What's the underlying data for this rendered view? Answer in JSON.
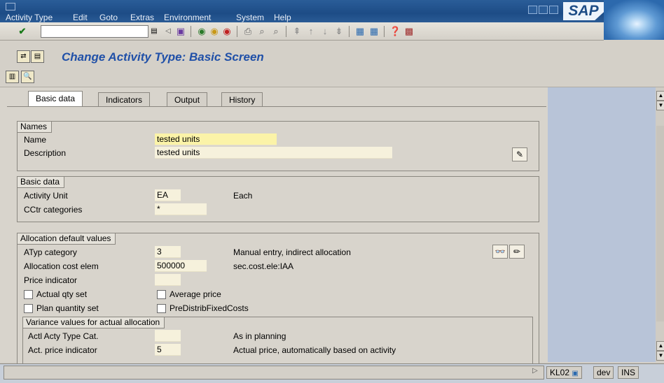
{
  "menubar": {
    "items": [
      "Activity Type",
      "Edit",
      "Goto",
      "Extras",
      "Environment",
      "System",
      "Help"
    ],
    "logo": "SAP"
  },
  "title": "Change Activity Type: Basic Screen",
  "tabs": [
    "Basic data",
    "Indicators",
    "Output",
    "History"
  ],
  "names": {
    "group_title": "Names",
    "name_label": "Name",
    "name_value": "tested units",
    "description_label": "Description",
    "description_value": "tested units"
  },
  "basic": {
    "group_title": "Basic data",
    "activity_unit_label": "Activity Unit",
    "activity_unit_value": "EA",
    "activity_unit_text": "Each",
    "cctr_label": "CCtr categories",
    "cctr_value": "*"
  },
  "alloc": {
    "group_title": "Allocation default values",
    "atyp_label": "ATyp category",
    "atyp_value": "3",
    "atyp_text": "Manual entry, indirect allocation",
    "cost_elem_label": "Allocation cost elem",
    "cost_elem_value": "500000",
    "cost_elem_text": "sec.cost.ele:IAA",
    "price_ind_label": "Price indicator",
    "actual_qty_label": "Actual qty set",
    "average_price_label": "Average price",
    "plan_qty_label": "Plan quantity set",
    "predistrib_label": "PreDistribFixedCosts"
  },
  "variance": {
    "group_title": "Variance values for actual allocation",
    "actl_acty_label": "Actl Acty Type Cat.",
    "actl_acty_text": "As in planning",
    "act_price_label": "Act. price indicator",
    "act_price_value": "5",
    "act_price_text": "Actual price, automatically based on activity"
  },
  "status": {
    "transaction": "KL02",
    "system": "dev",
    "mode": "INS"
  }
}
